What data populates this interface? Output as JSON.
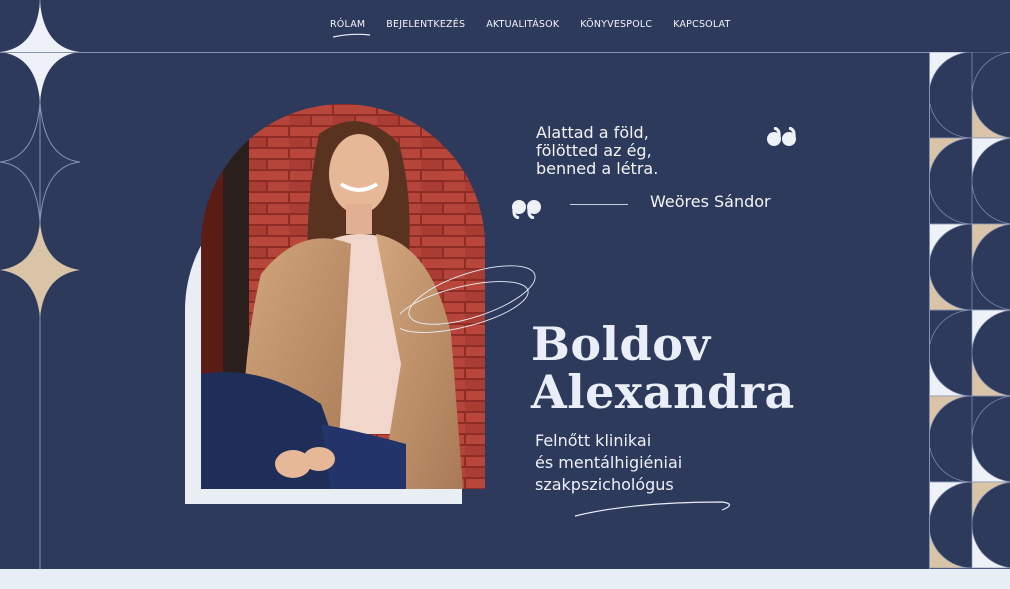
{
  "nav": {
    "items": [
      {
        "label": "RÓLAM"
      },
      {
        "label": "BEJELENTKEZÉS"
      },
      {
        "label": "AKTUALITÁSOK"
      },
      {
        "label": "KÖNYVESPOLC"
      },
      {
        "label": "KAPCSOLAT"
      }
    ],
    "active_index": 0
  },
  "quote": {
    "lines": [
      "Alattad a föld,",
      "fölötted az ég,",
      "benned a létra."
    ],
    "author": "Weöres Sándor"
  },
  "hero": {
    "name_line1": "Boldov",
    "name_line2": "Alexandra",
    "title_lines": [
      "Felnőtt klinikai",
      "és mentálhigiéniai",
      "szakpszichológus"
    ]
  },
  "colors": {
    "background": "#2d3a5c",
    "accent_beige": "#d9c4a8",
    "light": "#e9eef8"
  },
  "icons": [
    "quote-open-icon",
    "quote-close-icon",
    "sparkle-star-icon"
  ]
}
